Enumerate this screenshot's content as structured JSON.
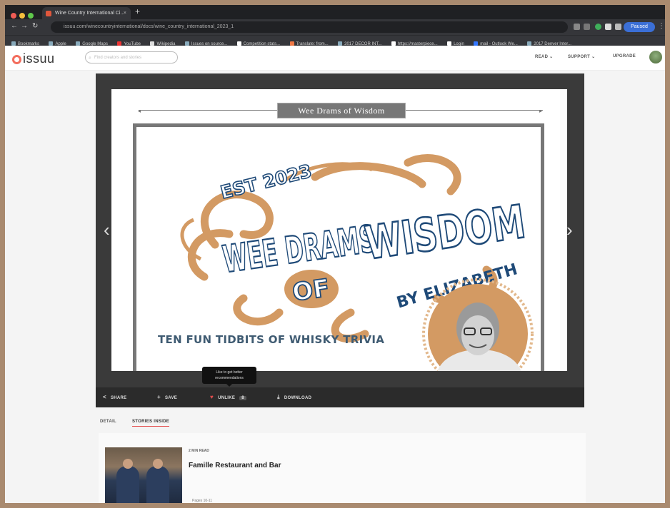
{
  "browser": {
    "tab_title": "Wine Country International Ci...",
    "url": "issuu.com/winecountryinternational/docs/wine_country_international_2023_1",
    "paused_label": "Paused",
    "bookmarks": [
      "Bookmarks",
      "Apple",
      "Google Maps",
      "YouTube",
      "Wikipedia",
      "Issues on source...",
      "Competition stats...",
      "Translate: from...",
      "2017 DECOR INT...",
      "https://masterpiece...",
      "Login",
      "mail - Outlook We...",
      "2017 Denver Inter..."
    ]
  },
  "issuu": {
    "logo": "issuu",
    "search_placeholder": "Find creators and stories",
    "menu": {
      "read": "READ",
      "support": "SUPPORT",
      "upgrade": "UPGRADE"
    }
  },
  "document": {
    "section_title": "Wee Drams of Wisdom",
    "cover": {
      "est": "EST 2023",
      "line1": "WEE DRAMS",
      "line2": "WISDOM",
      "of": "OF",
      "byline": "BY ELIZABETH"
    },
    "subtitle": "TEN FUN TIDBITS OF WHISKY TRIVIA"
  },
  "tooltip": {
    "line1": "Like to get better",
    "line2": "recommendations"
  },
  "toolbar": {
    "share": "SHARE",
    "save": "SAVE",
    "unlike": "UNLIKE",
    "like_count": "8",
    "download": "DOWNLOAD"
  },
  "detail_tabs": {
    "detail": "DETAIL",
    "stories": "STORIES INSIDE"
  },
  "story": {
    "read_time": "2 MIN READ",
    "title": "Famille Restaurant and Bar",
    "pages": "Pages 10-11"
  },
  "colors": {
    "accent": "#e34d4d",
    "copper": "#d39a63",
    "navy": "#1f4a78"
  }
}
